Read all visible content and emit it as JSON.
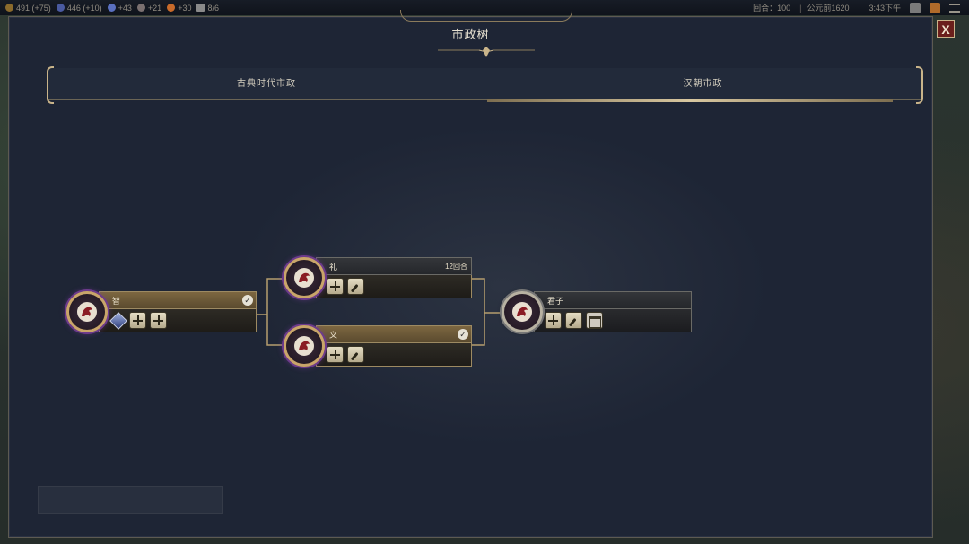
{
  "topbar": {
    "resources": [
      {
        "name": "gold",
        "value": "491",
        "delta": "(+75)",
        "color": "#8a6a2c"
      },
      {
        "name": "science",
        "value": "446",
        "delta": "(+10)",
        "color": "#4a5aa0"
      },
      {
        "name": "culture",
        "value": "+43",
        "color": "#5a70c0"
      },
      {
        "name": "faith",
        "value": "+21",
        "color": "#7a7070"
      },
      {
        "name": "amenity",
        "value": "+30",
        "color": "#c86a2a"
      },
      {
        "name": "units",
        "value": "8/6",
        "color": "#8a8a8a"
      }
    ],
    "turn": "回合：100",
    "year": "公元前1620",
    "clock": "3:43下午"
  },
  "panel": {
    "title": "市政树",
    "close_label": "X"
  },
  "tabs": [
    {
      "label": "古典时代市政",
      "selected": false
    },
    {
      "label": "汉朝市政",
      "selected": true
    }
  ],
  "civics": [
    {
      "id": "zhi",
      "name": "智",
      "completed": true,
      "icons": [
        "gem-icon",
        "plus-icon",
        "plus-icon"
      ]
    },
    {
      "id": "li",
      "name": "礼",
      "turns": "12回合",
      "completed": false,
      "icons": [
        "plus-icon",
        "leaf-icon"
      ]
    },
    {
      "id": "yi",
      "name": "义",
      "completed": true,
      "icons": [
        "plus-icon",
        "leaf-icon"
      ]
    },
    {
      "id": "junzi",
      "name": "君子",
      "completed": false,
      "locked": true,
      "icons": [
        "plus-icon",
        "leaf-icon",
        "building-icon"
      ]
    }
  ],
  "colors": {
    "panel_bg": "#1e2535",
    "gold": "#c9b48a",
    "purple_glow": "#6d3a8c",
    "close_red": "#6b1f1c"
  }
}
